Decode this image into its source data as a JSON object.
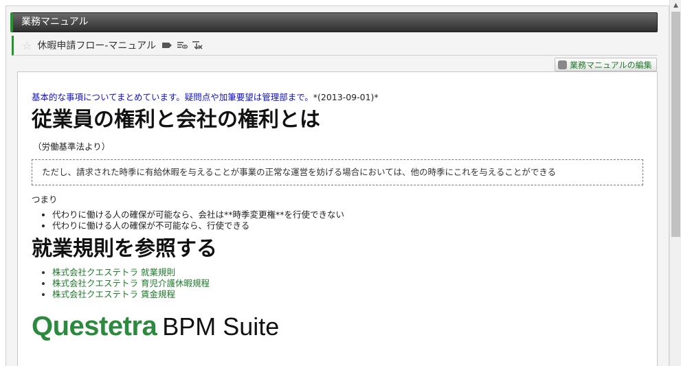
{
  "header": {
    "title": "業務マニュアル"
  },
  "page": {
    "title": "休暇申請フロー-マニュアル"
  },
  "toolbar": {
    "edit_label": "業務マニュアルの編集",
    "icons": [
      "tag-icon",
      "watch-icon",
      "unfollow-icon"
    ]
  },
  "content": {
    "intro_blue": "基本的な事項についてまとめています。疑問点や加筆要望は管理部まで。",
    "intro_date": "*(2013-09-01)*",
    "heading1": "従業員の権利と会社の権利とは",
    "source": "（労働基準法より）",
    "quote": "ただし、請求された時季に有給休暇を与えることが事業の正常な運営を妨げる場合においては、他の時季にこれを与えることができる",
    "tsumari": "つまり",
    "bullets": [
      "代わりに働ける人の確保が可能なら、会社は**時季変更権**を行使できない",
      "代わりに働ける人の確保が不可能なら、行使できる"
    ],
    "heading2": "就業規則を参照する",
    "links": [
      "株式会社クエステトラ 就業規則",
      "株式会社クエステトラ 育児介護休暇規程",
      "株式会社クエステトラ 賃金規程"
    ],
    "logo_green": "Questetra",
    "logo_black": "BPM Suite"
  },
  "colors": {
    "accent": "#1f9a2a",
    "link": "#1f7a2a",
    "intro": "#1010d0"
  }
}
